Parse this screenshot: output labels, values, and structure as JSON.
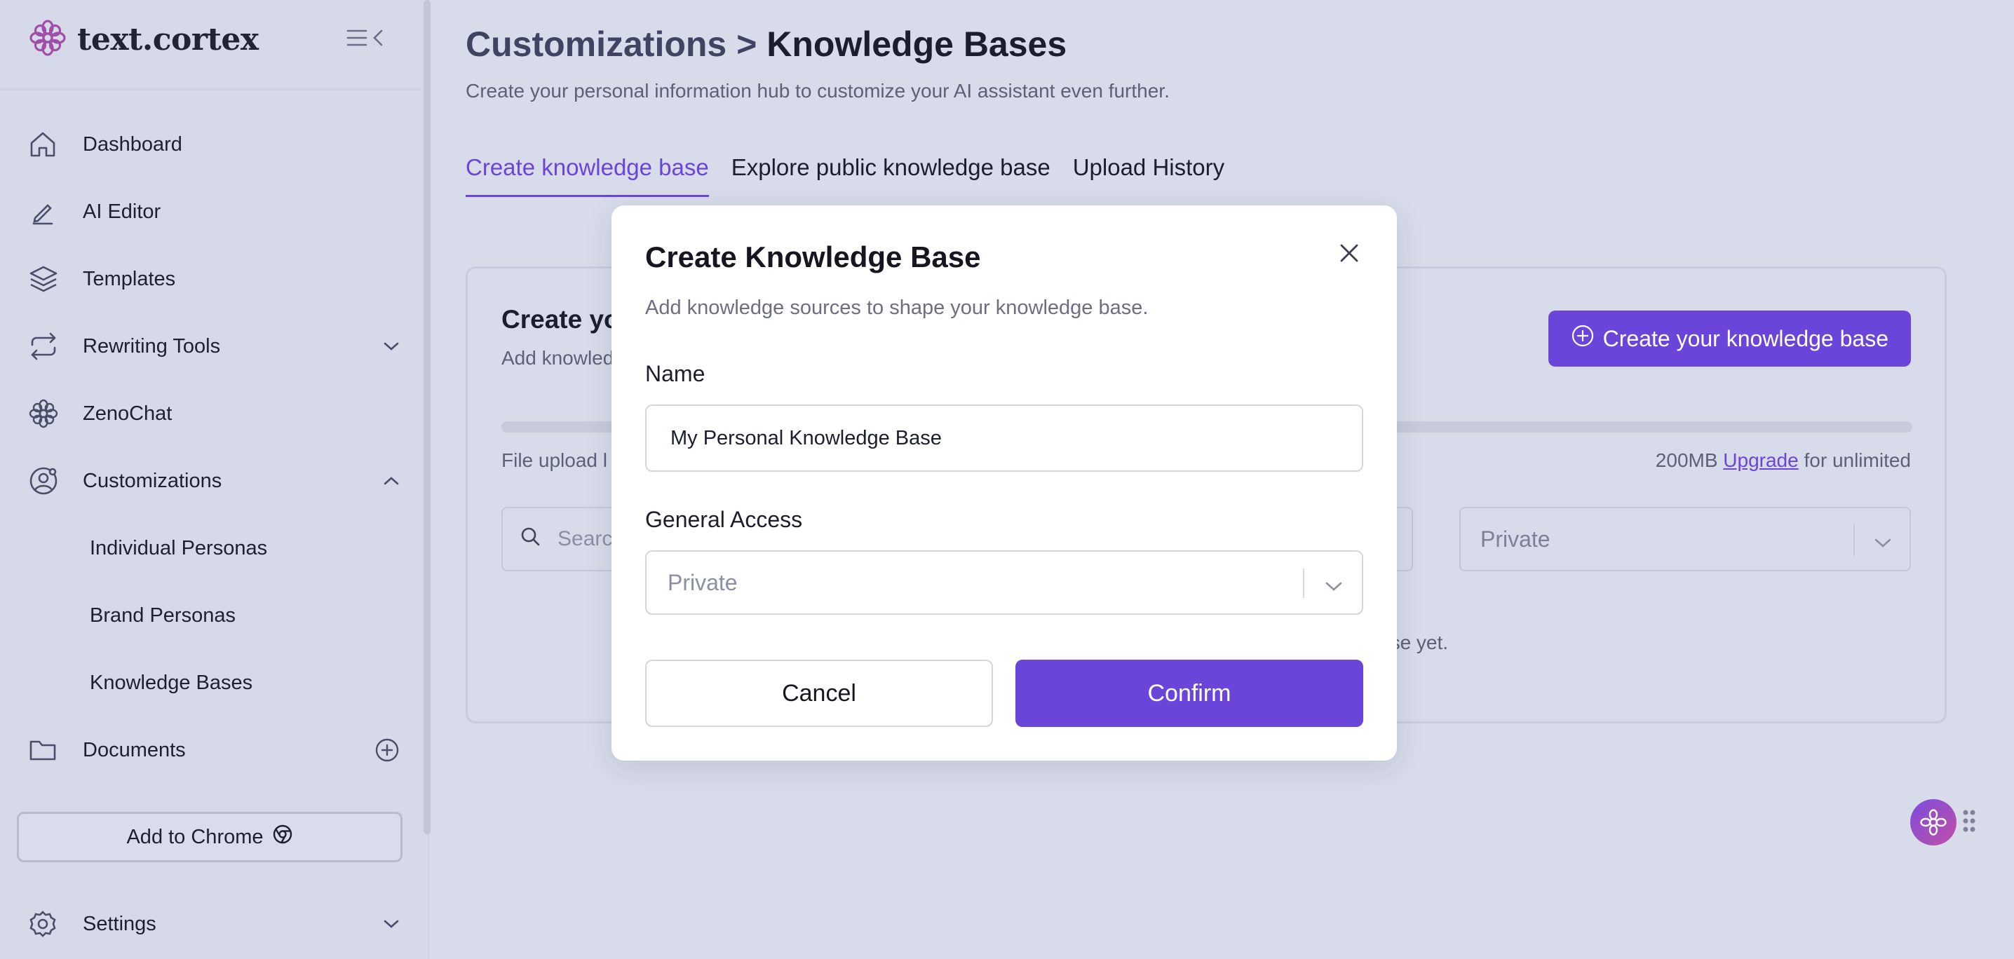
{
  "brand": {
    "name": "text.cortex"
  },
  "sidebar": {
    "items": [
      {
        "label": "Dashboard",
        "icon": "home-icon"
      },
      {
        "label": "AI Editor",
        "icon": "pen-icon"
      },
      {
        "label": "Templates",
        "icon": "layers-icon"
      },
      {
        "label": "Rewriting Tools",
        "icon": "repeat-icon",
        "chevron": "down"
      },
      {
        "label": "ZenoChat",
        "icon": "flower-icon"
      },
      {
        "label": "Customizations",
        "icon": "user-circle-icon",
        "chevron": "up"
      },
      {
        "label": "Individual Personas"
      },
      {
        "label": "Brand Personas"
      },
      {
        "label": "Knowledge Bases"
      },
      {
        "label": "Documents",
        "icon": "folder-icon"
      }
    ],
    "add_chrome": "Add to Chrome",
    "settings": "Settings"
  },
  "header": {
    "breadcrumb_parent": "Customizations >",
    "title": "Knowledge Bases",
    "subtitle": "Create your personal information hub to customize your AI assistant even further."
  },
  "tabs": [
    {
      "label": "Create knowledge base",
      "active": true
    },
    {
      "label": "Explore public knowledge base",
      "active": false
    },
    {
      "label": "Upload History",
      "active": false
    }
  ],
  "card": {
    "title_partial": "Create yo",
    "subtitle_partial": "Add knowled",
    "create_button": "Create your knowledge base",
    "upload_label_partial": "File upload l",
    "storage_text": "200MB",
    "upgrade_link": "Upgrade",
    "storage_suffix": "for unlimited",
    "search_placeholder_partial": "Searc",
    "access_value": "Private",
    "empty_partial": "ase yet."
  },
  "modal": {
    "title": "Create Knowledge Base",
    "subtitle": "Add knowledge sources to shape your knowledge base.",
    "name_label": "Name",
    "name_value": "My Personal Knowledge Base",
    "access_label": "General Access",
    "access_value": "Private",
    "cancel": "Cancel",
    "confirm": "Confirm"
  },
  "colors": {
    "accent": "#6b45d9",
    "background": "#d8dbe9",
    "modal": "#ffffff"
  }
}
